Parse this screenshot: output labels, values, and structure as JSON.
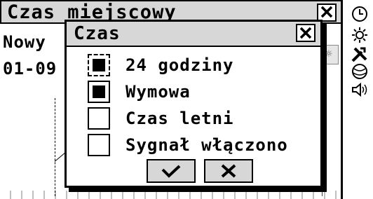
{
  "background": {
    "title": "Czas miejscowy",
    "line1": "Nowy",
    "line2": "01-09"
  },
  "dialog": {
    "title": "Czas",
    "options": [
      {
        "label": "24 godziny",
        "checked": true,
        "focused": true
      },
      {
        "label": "Wymowa",
        "checked": true,
        "focused": false
      },
      {
        "label": "Czas letni",
        "checked": false,
        "focused": false
      },
      {
        "label": "Sygnał włączono",
        "checked": false,
        "focused": false
      }
    ],
    "ok_icon": "checkmark-icon",
    "cancel_icon": "close-icon"
  },
  "toolbar": {
    "icons": [
      "clock-icon",
      "sun-icon",
      "tools-icon",
      "globe-icon",
      "speaker-icon"
    ]
  }
}
